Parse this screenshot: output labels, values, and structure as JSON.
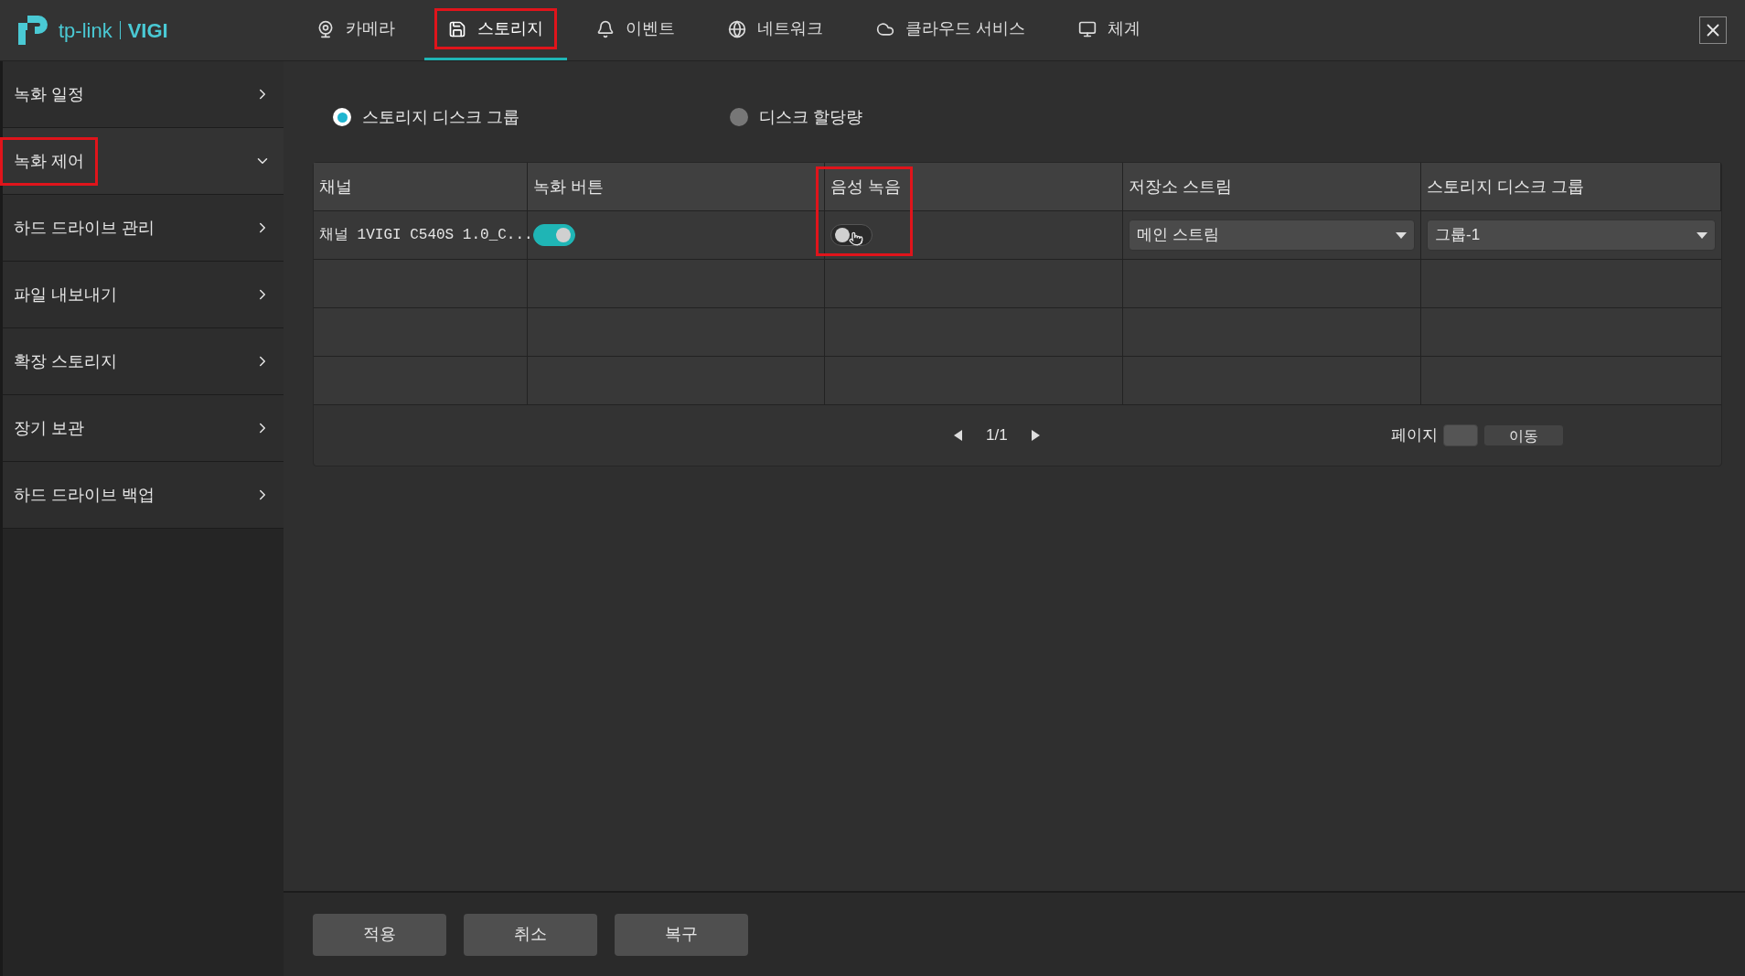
{
  "logo": {
    "brand": "tp-link",
    "product": "VIGI"
  },
  "nav_tabs": [
    {
      "kind": "camera",
      "label": "카메라",
      "selected": false,
      "highlighted": false
    },
    {
      "kind": "storage",
      "label": "스토리지",
      "selected": true,
      "highlighted": true
    },
    {
      "kind": "event",
      "label": "이벤트",
      "selected": false,
      "highlighted": false
    },
    {
      "kind": "network",
      "label": "네트워크",
      "selected": false,
      "highlighted": false
    },
    {
      "kind": "cloud",
      "label": "클라우드 서비스",
      "selected": false,
      "highlighted": false
    },
    {
      "kind": "system",
      "label": "체계",
      "selected": false,
      "highlighted": false
    }
  ],
  "sidebar": {
    "items": [
      {
        "label": "녹화 일정",
        "expanded": false,
        "highlighted": false
      },
      {
        "label": "녹화 제어",
        "expanded": true,
        "highlighted": true
      },
      {
        "label": "하드 드라이브 관리",
        "expanded": false,
        "highlighted": false
      },
      {
        "label": "파일 내보내기",
        "expanded": false,
        "highlighted": false
      },
      {
        "label": "확장 스토리지",
        "expanded": false,
        "highlighted": false
      },
      {
        "label": "장기 보관",
        "expanded": false,
        "highlighted": false
      },
      {
        "label": "하드 드라이브 백업",
        "expanded": false,
        "highlighted": false
      }
    ]
  },
  "mode_options": [
    {
      "label": "스토리지 디스크 그룹",
      "selected": true
    },
    {
      "label": "디스크 할당량",
      "selected": false
    }
  ],
  "table": {
    "columns": [
      {
        "label": "채널",
        "highlighted": false
      },
      {
        "label": "녹화 버튼",
        "highlighted": false
      },
      {
        "label": "음성 녹음",
        "highlighted": true
      },
      {
        "label": "저장소 스트림",
        "highlighted": false
      },
      {
        "label": "스토리지 디스크 그룹",
        "highlighted": false
      }
    ],
    "rows": [
      {
        "channel": "채널 1VIGI C540S 1.0_C...",
        "record_on": true,
        "audio_on": false,
        "stream": "메인 스트림",
        "disk_group": "그룹-1"
      }
    ]
  },
  "pagination": {
    "page": "1/1",
    "page_label": "페이지",
    "go_button": "이동"
  },
  "buttons": [
    "적용",
    "취소",
    "복구"
  ]
}
